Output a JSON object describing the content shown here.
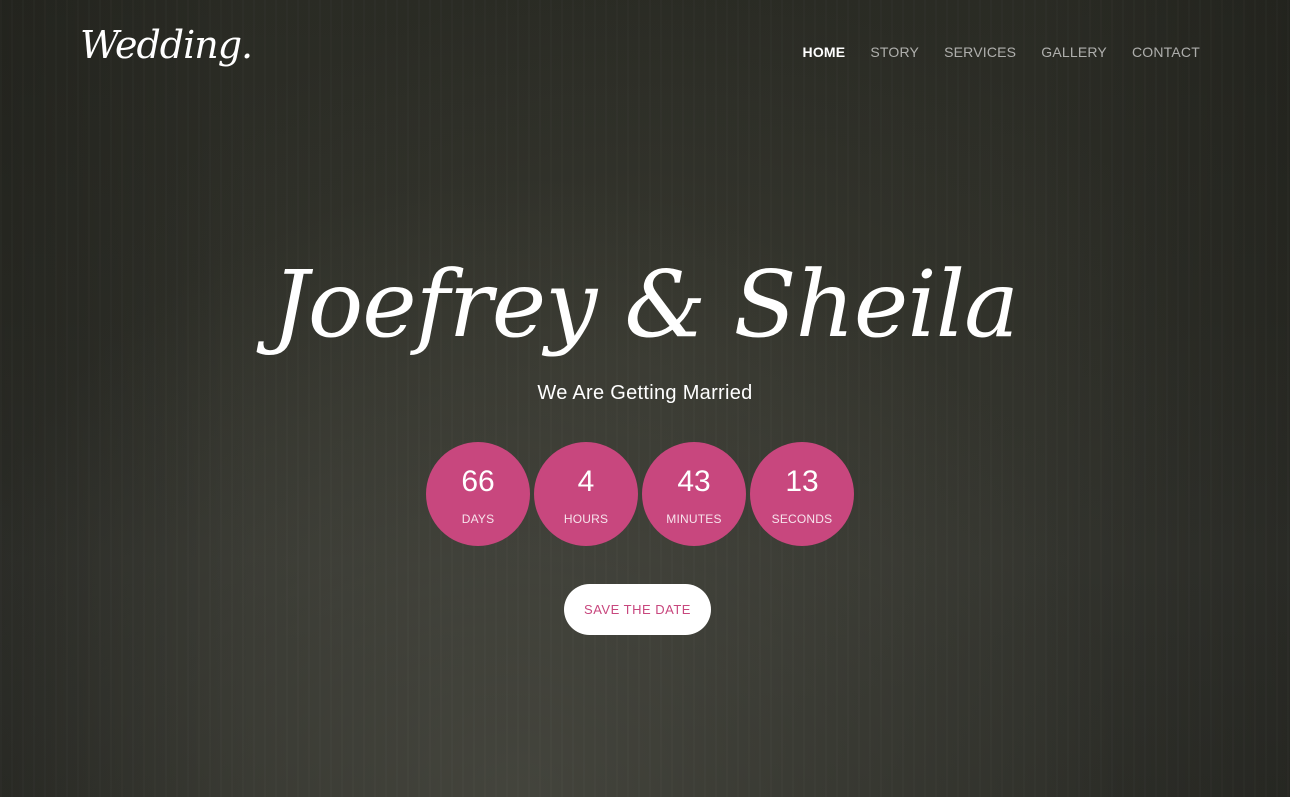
{
  "header": {
    "logo": "Wedding.",
    "nav": [
      {
        "label": "HOME",
        "active": true
      },
      {
        "label": "STORY",
        "active": false
      },
      {
        "label": "SERVICES",
        "active": false
      },
      {
        "label": "GALLERY",
        "active": false
      },
      {
        "label": "CONTACT",
        "active": false
      }
    ]
  },
  "hero": {
    "names": "Joefrey & Sheila",
    "subtitle": "We Are Getting Married"
  },
  "countdown": [
    {
      "value": "66",
      "label": "DAYS"
    },
    {
      "value": "4",
      "label": "HOURS"
    },
    {
      "value": "43",
      "label": "MINUTES"
    },
    {
      "value": "13",
      "label": "SECONDS"
    }
  ],
  "cta": {
    "label": "SAVE THE DATE"
  },
  "colors": {
    "accent": "#c8477e",
    "background": "#2f3029"
  }
}
